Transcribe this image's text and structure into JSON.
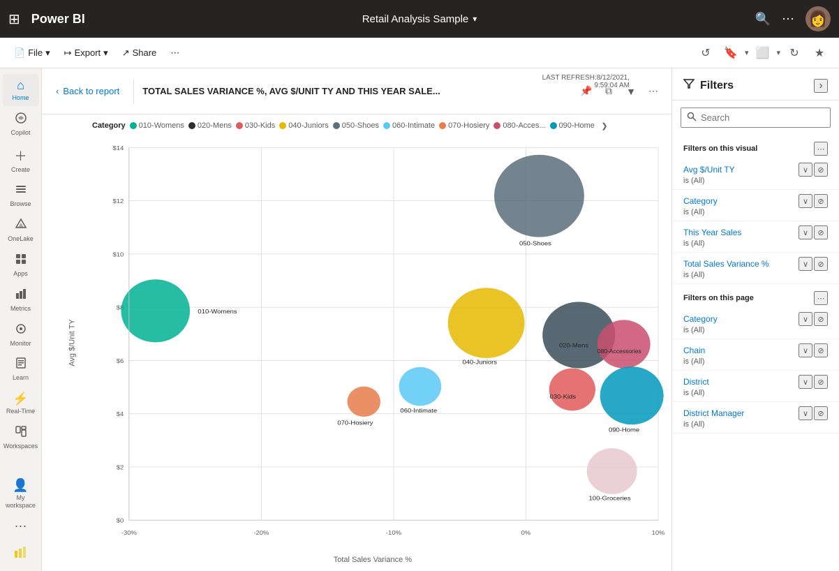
{
  "topbar": {
    "waffle_label": "⊞",
    "logo": "Power BI",
    "title": "Retail Analysis Sample",
    "chevron": "▾",
    "search_icon": "🔍",
    "more_icon": "⋯"
  },
  "cmdbar": {
    "file_label": "File",
    "export_label": "Export",
    "share_label": "Share",
    "more_icon": "⋯"
  },
  "sidebar": {
    "items": [
      {
        "id": "home",
        "icon": "⌂",
        "label": "Home"
      },
      {
        "id": "copilot",
        "icon": "✦",
        "label": "Copilot"
      },
      {
        "id": "create",
        "icon": "+",
        "label": "Create"
      },
      {
        "id": "browse",
        "icon": "☰",
        "label": "Browse"
      },
      {
        "id": "onelake",
        "icon": "◎",
        "label": "OneLake"
      },
      {
        "id": "apps",
        "icon": "⊞",
        "label": "Apps"
      },
      {
        "id": "metrics",
        "icon": "⊟",
        "label": "Metrics"
      },
      {
        "id": "monitor",
        "icon": "◉",
        "label": "Monitor"
      },
      {
        "id": "learn",
        "icon": "◫",
        "label": "Learn"
      },
      {
        "id": "realtime",
        "icon": "⚡",
        "label": "Real-Time"
      },
      {
        "id": "workspaces",
        "icon": "⊡",
        "label": "Workspaces"
      }
    ],
    "bottom": [
      {
        "id": "my-workspace",
        "icon": "👤",
        "label": "My workspace"
      },
      {
        "id": "more",
        "icon": "⋯",
        "label": ""
      }
    ],
    "powerbi_icon": "📊"
  },
  "chart_header": {
    "back_label": "Back to report",
    "title": "TOTAL SALES VARIANCE %, AVG $/UNIT TY AND THIS YEAR SALE...",
    "refresh_label": "LAST REFRESH:8/12/2021,",
    "refresh_time": "9:59:04 AM"
  },
  "chart": {
    "y_axis_label": "Avg $/Unit TY",
    "x_axis_label": "Total Sales Variance %",
    "legend_category": "Category",
    "y_ticks": [
      "$14",
      "$12",
      "$10",
      "$8",
      "$6",
      "$4",
      "$2",
      "$0"
    ],
    "x_ticks": [
      "-30%",
      "-20%",
      "-10%",
      "0%",
      "10%"
    ],
    "bubbles": [
      {
        "id": "010-Womens",
        "color": "#00b294",
        "cx": 12,
        "cy": 465,
        "r": 36,
        "label_x": 220,
        "label_y": 490,
        "label": "010-Womens"
      },
      {
        "id": "020-Mens",
        "color": "#3b4f5c",
        "cx": 730,
        "cy": 540,
        "r": 45,
        "label_x": 720,
        "label_y": 565,
        "label": "020-Mens"
      },
      {
        "id": "030-Kids",
        "color": "#e05b5b",
        "cx": 730,
        "cy": 618,
        "r": 32,
        "label_x": 730,
        "label_y": 630,
        "label": "030-Kids"
      },
      {
        "id": "040-Juniors",
        "color": "#e6b800",
        "cx": 600,
        "cy": 508,
        "r": 48,
        "label_x": 600,
        "label_y": 555,
        "label": "040-Juniors"
      },
      {
        "id": "050-Shoes",
        "color": "#5b6f7a",
        "cx": 665,
        "cy": 245,
        "r": 60,
        "label_x": 665,
        "label_y": 305,
        "label": "050-Shoes"
      },
      {
        "id": "060-Intimate",
        "color": "#5bc8f5",
        "cx": 490,
        "cy": 585,
        "r": 28,
        "label_x": 510,
        "label_y": 638,
        "label": "060-Intimate"
      },
      {
        "id": "070-Hosiery",
        "color": "#e87d4b",
        "cx": 415,
        "cy": 610,
        "r": 22,
        "label_x": 420,
        "label_y": 656,
        "label": "070-Hosiery"
      },
      {
        "id": "080-Accessories",
        "color": "#c94f6e",
        "cx": 795,
        "cy": 560,
        "r": 38,
        "label_x": 800,
        "label_y": 570,
        "label": "080-Accessories"
      },
      {
        "id": "090-Home",
        "color": "#0099bc",
        "cx": 820,
        "cy": 610,
        "r": 42,
        "label_x": 808,
        "label_y": 680,
        "label": "090-Home"
      },
      {
        "id": "100-Groceries",
        "color": "#e8c8d0",
        "cx": 790,
        "cy": 720,
        "r": 35,
        "label_x": 790,
        "label_y": 750,
        "label": "100-Groceries"
      }
    ],
    "legend_items": [
      {
        "id": "010-Womens",
        "color": "#00b294",
        "label": "010-Womens"
      },
      {
        "id": "020-Mens",
        "color": "#2c2c2c",
        "label": "020-Mens"
      },
      {
        "id": "030-Kids",
        "color": "#e05b5b",
        "label": "030-Kids"
      },
      {
        "id": "040-Juniors",
        "color": "#e6b800",
        "label": "040-Juniors"
      },
      {
        "id": "050-Shoes",
        "color": "#5b6f7a",
        "label": "050-Shoes"
      },
      {
        "id": "060-Intimate",
        "color": "#5bc8f5",
        "label": "060-Intimate"
      },
      {
        "id": "070-Hosiery",
        "color": "#e87d4b",
        "label": "070-Hosiery"
      },
      {
        "id": "080-Accessories",
        "color": "#c94f6e",
        "label": "080-Acces..."
      },
      {
        "id": "090-Home",
        "color": "#0099bc",
        "label": "090-Home"
      }
    ]
  },
  "filters": {
    "title": "Filters",
    "search_placeholder": "Search",
    "sections": [
      {
        "id": "visual",
        "title": "Filters on this visual",
        "items": [
          {
            "name": "Avg $/Unit TY",
            "value": "is (All)"
          },
          {
            "name": "Category",
            "value": "is (All)"
          },
          {
            "name": "This Year Sales",
            "value": "is (All)"
          },
          {
            "name": "Total Sales Variance %",
            "value": "is (All)"
          }
        ]
      },
      {
        "id": "page",
        "title": "Filters on this page",
        "items": [
          {
            "name": "Category",
            "value": "is (All)"
          },
          {
            "name": "Chain",
            "value": "is (All)"
          },
          {
            "name": "District",
            "value": "is (All)"
          },
          {
            "name": "District Manager",
            "value": "is (All)"
          }
        ]
      }
    ]
  }
}
